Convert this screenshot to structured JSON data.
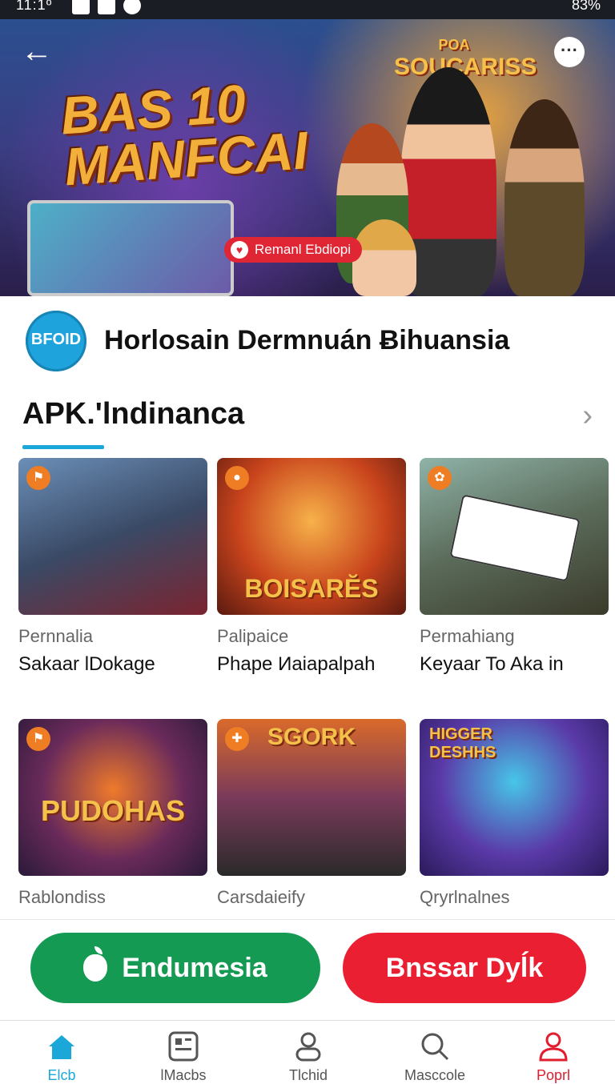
{
  "status": {
    "time": "11:1º",
    "battery": "83%"
  },
  "hero": {
    "title": "BAS 10 MANFCAI",
    "brand_top": "POA",
    "brand": "SOUCARISS",
    "pill": "Remanl Ebdiopi"
  },
  "app": {
    "logo_text": "BFOID",
    "name": "Horlosain Dermnuán  Ƀihuansia"
  },
  "section": {
    "title": "APK.'lndinanca"
  },
  "cards": [
    {
      "sub": "Pernnalia",
      "name": "Sakaar lDokage",
      "art": ""
    },
    {
      "sub": "Palipaice",
      "name": "Phape Иaiapalpah",
      "art": "BOISARĔS"
    },
    {
      "sub": "Permahiang",
      "name": "Keyaar To Aka in",
      "art": ""
    },
    {
      "sub": "Rablondiss",
      "name": "",
      "art": "PUDOHAS"
    },
    {
      "sub": "Carsdaieify",
      "name": "",
      "art": "SGORK"
    },
    {
      "sub": "Qryrlnalnes",
      "name": "",
      "art": "HIGGER DESHHS"
    }
  ],
  "buttons": {
    "primary": "Endumesia",
    "secondary": "Bnssar Dyĺk"
  },
  "nav": [
    {
      "label": "Elcb"
    },
    {
      "label": "lMacbs"
    },
    {
      "label": "Tlchid"
    },
    {
      "label": "Masccole"
    },
    {
      "label": "Poprl"
    }
  ],
  "colors": {
    "accent": "#1ca7d9",
    "green": "#149a52",
    "red": "#ea1f32",
    "badge": "#ef7d24"
  }
}
